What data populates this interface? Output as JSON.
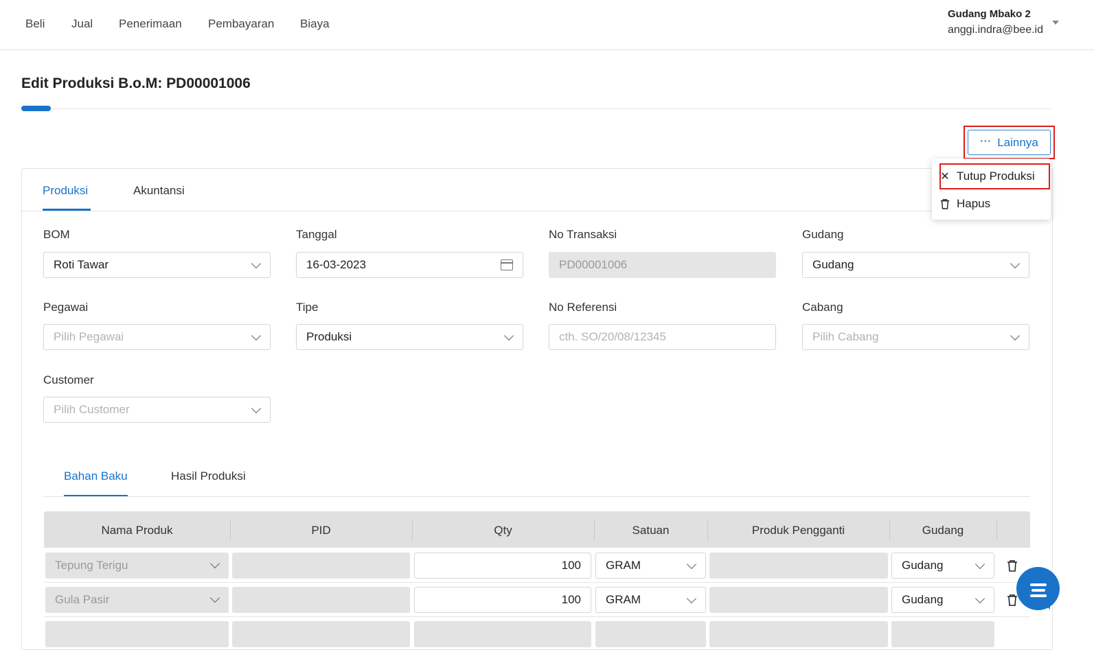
{
  "nav": {
    "items": [
      "Beli",
      "Jual",
      "Penerimaan",
      "Pembayaran",
      "Biaya"
    ]
  },
  "account": {
    "warehouse": "Gudang Mbako 2",
    "email": "anggi.indra@bee.id"
  },
  "page": {
    "title": "Edit Produksi B.o.M: PD00001006"
  },
  "more_button": {
    "label": "Lainnya"
  },
  "dropdown": {
    "close_label": "Tutup Produksi",
    "delete_label": "Hapus"
  },
  "tabs": {
    "produksi": "Produksi",
    "akuntansi": "Akuntansi"
  },
  "form": {
    "bom": {
      "label": "BOM",
      "value": "Roti Tawar"
    },
    "tanggal": {
      "label": "Tanggal",
      "value": "16-03-2023"
    },
    "no_transaksi": {
      "label": "No Transaksi",
      "value": "PD00001006"
    },
    "gudang": {
      "label": "Gudang",
      "value": "Gudang"
    },
    "pegawai": {
      "label": "Pegawai",
      "placeholder": "Pilih Pegawai"
    },
    "tipe": {
      "label": "Tipe",
      "value": "Produksi"
    },
    "no_referensi": {
      "label": "No Referensi",
      "placeholder": "cth. SO/20/08/12345"
    },
    "cabang": {
      "label": "Cabang",
      "placeholder": "Pilih Cabang"
    },
    "customer": {
      "label": "Customer",
      "placeholder": "Pilih Customer"
    }
  },
  "subtabs": {
    "bahan_baku": "Bahan Baku",
    "hasil_produksi": "Hasil Produksi"
  },
  "table": {
    "headers": [
      "Nama Produk",
      "PID",
      "Qty",
      "Satuan",
      "Produk Pengganti",
      "Gudang"
    ],
    "rows": [
      {
        "nama_produk": "Tepung Terigu",
        "pid": "",
        "qty": "100",
        "satuan": "GRAM",
        "produk_pengganti": "",
        "gudang": "Gudang"
      },
      {
        "nama_produk": "Gula Pasir",
        "pid": "",
        "qty": "100",
        "satuan": "GRAM",
        "produk_pengganti": "",
        "gudang": "Gudang"
      }
    ]
  },
  "colors": {
    "accent": "#1a73c9",
    "highlight": "#e01b1b"
  }
}
